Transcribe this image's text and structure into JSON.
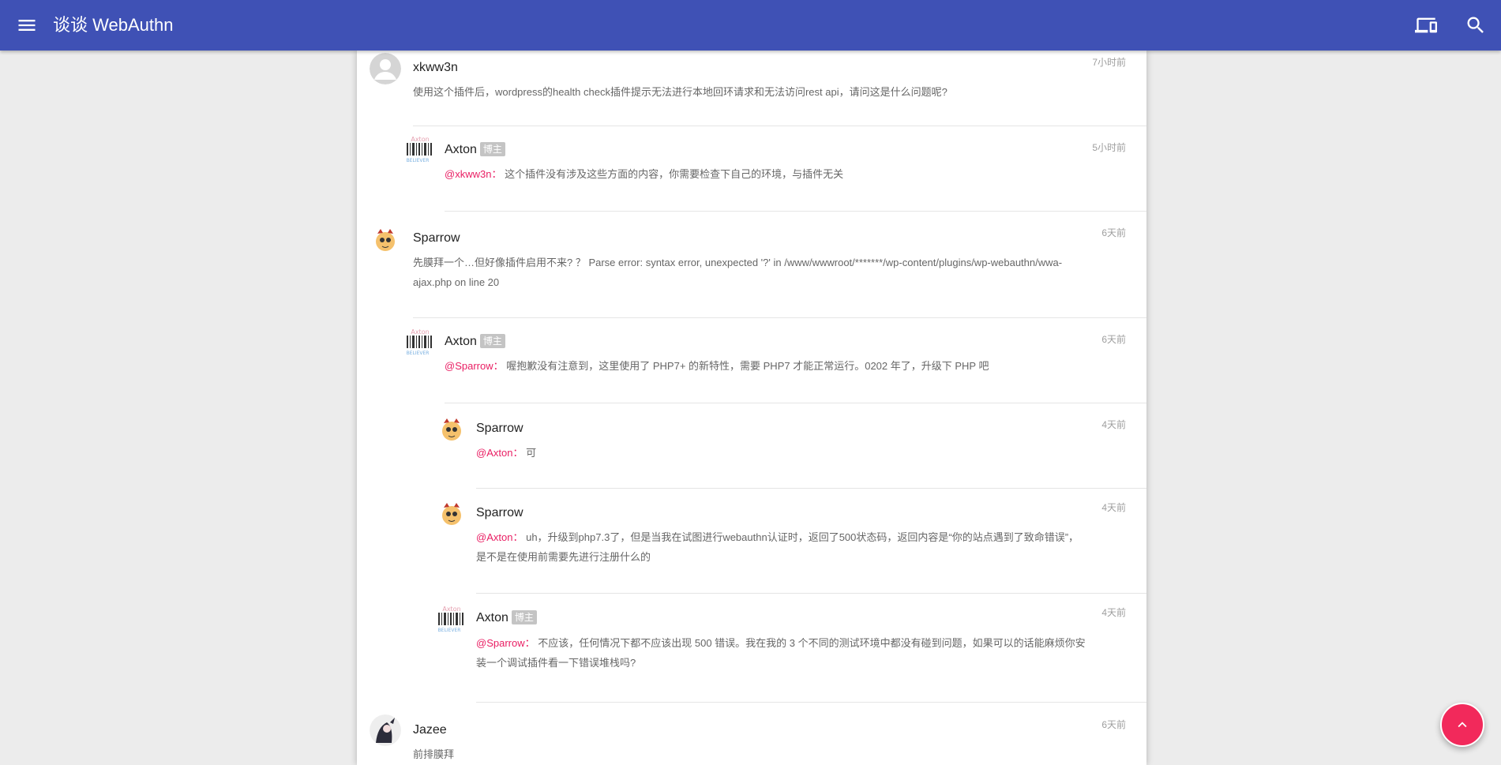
{
  "app": {
    "title": "谈谈 WebAuthn",
    "icons": {
      "menu": "menu-icon",
      "devices": "devices-icon",
      "search": "search-icon",
      "back_to_top": "arrow-up-icon"
    },
    "colors": {
      "appbar": "#3f51b5",
      "mention": "#e91e63",
      "fab": "#f2295b",
      "badge": "#c4c4c4"
    }
  },
  "comments": [
    {
      "author": "xkww3n",
      "time": "7小时前",
      "text": "使用这个插件后，wordpress的health check插件提示无法进行本地回环请求和无法访问rest api，请问这是什么问题呢?",
      "avatar": "default-avatar"
    },
    {
      "author": "Axton",
      "badge": "博主",
      "time": "5小时前",
      "mention": "@xkww3n",
      "sep": "：",
      "text": "这个插件没有涉及这些方面的内容，你需要检查下自己的环境，与插件无关",
      "avatar": "barcode-avatar",
      "avatar_text_top": "Axton",
      "avatar_text_bottom": "BELIEVER"
    },
    {
      "author": "Sparrow",
      "time": "6天前",
      "text_line1": "先膜拜一个…但好像插件启用不来? ？ Parse error: syntax error, unexpected '?' in /www/wwwroot/*******/wp-content/plugins/wp-webauthn/wwa-",
      "text_line2": "ajax.php on line 20",
      "avatar": "cartoon-cat-avatar"
    },
    {
      "author": "Axton",
      "badge": "博主",
      "time": "6天前",
      "mention": "@Sparrow",
      "sep": "：",
      "text": "喔抱歉没有注意到，这里使用了 PHP7+ 的新特性，需要 PHP7 才能正常运行。0202 年了，升级下 PHP 吧",
      "avatar": "barcode-avatar",
      "avatar_text_top": "Axton",
      "avatar_text_bottom": "BELIEVER"
    },
    {
      "author": "Sparrow",
      "time": "4天前",
      "mention": "@Axton",
      "sep": "：",
      "text": "可",
      "avatar": "cartoon-cat-avatar"
    },
    {
      "author": "Sparrow",
      "time": "4天前",
      "mention": "@Axton",
      "sep": "：",
      "text_line1": "uh，升级到php7.3了，但是当我在试图进行webauthn认证时，返回了500状态码，返回内容是“你的站点遇到了致命错误”，",
      "text_line2": "是不是在使用前需要先进行注册什么的",
      "avatar": "cartoon-cat-avatar"
    },
    {
      "author": "Axton",
      "badge": "博主",
      "time": "4天前",
      "mention": "@Sparrow",
      "sep": "：",
      "text_line1": "不应该，任何情况下都不应该出现 500 错误。我在我的 3 个不同的测试环境中都没有碰到问题，如果可以的话能麻烦你安",
      "text_line2": "装一个调试插件看一下错误堆栈吗?",
      "avatar": "barcode-avatar",
      "avatar_text_top": "Axton",
      "avatar_text_bottom": "BELIEVER"
    },
    {
      "author": "Jazee",
      "time": "6天前",
      "text": "前排膜拜",
      "avatar": "dark-character-avatar"
    }
  ]
}
